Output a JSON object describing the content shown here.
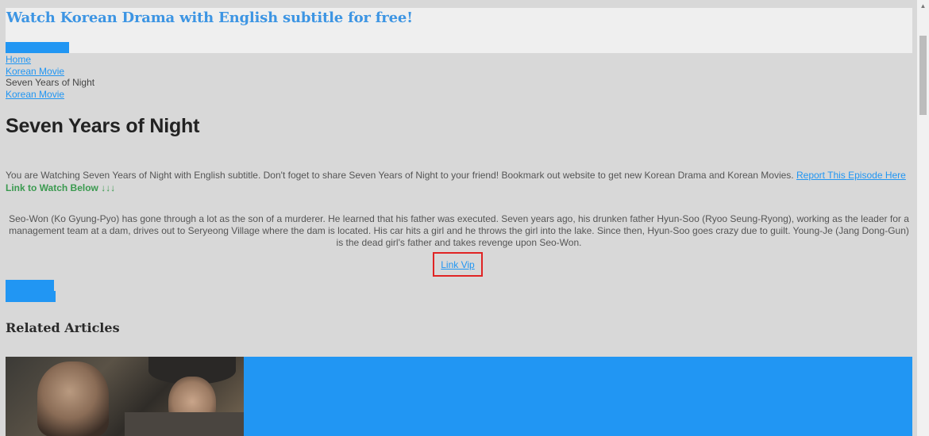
{
  "header": {
    "site_title": "Watch Korean Drama with English subtitle for free!"
  },
  "breadcrumb": {
    "home": "Home",
    "category": "Korean Movie",
    "current": "Seven Years of Night",
    "category_tag": "Korean Movie"
  },
  "post": {
    "title": "Seven Years of Night",
    "intro_text": "You are Watching Seven Years of Night with English subtitle. Don't foget to share Seven Years of Night to your friend! Bookmark out website to get new Korean Drama and Korean Movies.",
    "report_link": "Report This Episode Here",
    "watch_below": "Link to Watch Below ↓↓↓",
    "synopsis": "Seo-Won (Ko Gyung-Pyo) has gone through a lot as the son of a murderer. He learned that his father was executed. Seven years ago, his drunken father Hyun-Soo (Ryoo Seung-Ryong), working as the leader for a management team at a dam, drives out to Seryeong Village where the dam is located. His car hits a girl and he throws the girl into the lake. Since then, Hyun-Soo goes crazy due to guilt. Young-Je (Jang Dong-Gun) is the dead girl's father and takes revenge upon Seo-Won.",
    "link_vip": "Link Vip"
  },
  "related": {
    "heading": "Related Articles"
  },
  "colors": {
    "accent": "#2196f3",
    "highlight_border": "#e02424",
    "watch_green": "#3a9a4f",
    "background": "#d8d8d8"
  },
  "icons": {
    "scroll_up": "caret-up-icon"
  }
}
